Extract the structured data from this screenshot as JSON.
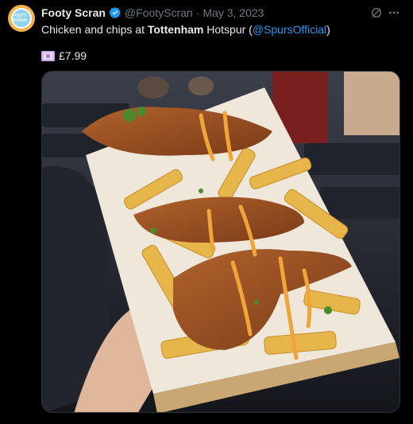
{
  "author": {
    "name": "Footy Scran",
    "handle": "@FootyScran",
    "separator": "·",
    "date": "May 3, 2023",
    "avatar_text": "FOOTY SCRAN"
  },
  "tweet": {
    "text_part1": "Chicken and chips at ",
    "text_bold1": "Tottenham",
    "text_part2": " Hotspur (",
    "mention": "@SpursOfficial",
    "text_part3": ")",
    "price": "£7.99"
  },
  "icons": {
    "verified": "verified-badge-icon",
    "grok": "grok-icon",
    "more": "more-icon",
    "money": "money-bag-icon"
  },
  "colors": {
    "background": "#000000",
    "text": "#e7e9ea",
    "muted": "#71767b",
    "link": "#1d9bf0",
    "verified": "#1d9bf0"
  }
}
